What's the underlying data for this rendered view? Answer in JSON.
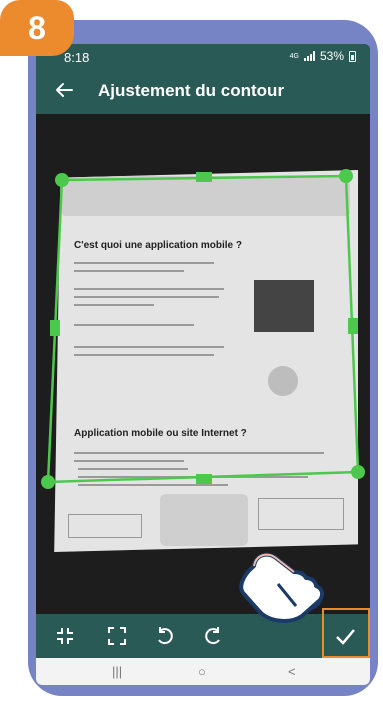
{
  "step_badge": "8",
  "status_bar": {
    "time": "8:18",
    "network": "4G",
    "battery": "53%"
  },
  "app_bar": {
    "title": "Ajustement du contour",
    "back_icon": "arrow-left-icon"
  },
  "document": {
    "heading_1": "C'est quoi une application mobile ?",
    "heading_2": "Application mobile ou site Internet ?"
  },
  "toolbar": {
    "icons": [
      "collapse-crop-icon",
      "expand-crop-icon",
      "rotate-left-icon",
      "rotate-right-icon",
      "confirm-check-icon"
    ]
  },
  "nav_bar": {
    "recents": "|||",
    "home": "○",
    "back": "<"
  },
  "colors": {
    "accent": "#2a5a55",
    "crop_outline": "#4cc94c",
    "badge": "#ec8a2e",
    "frame": "#7683c4"
  }
}
